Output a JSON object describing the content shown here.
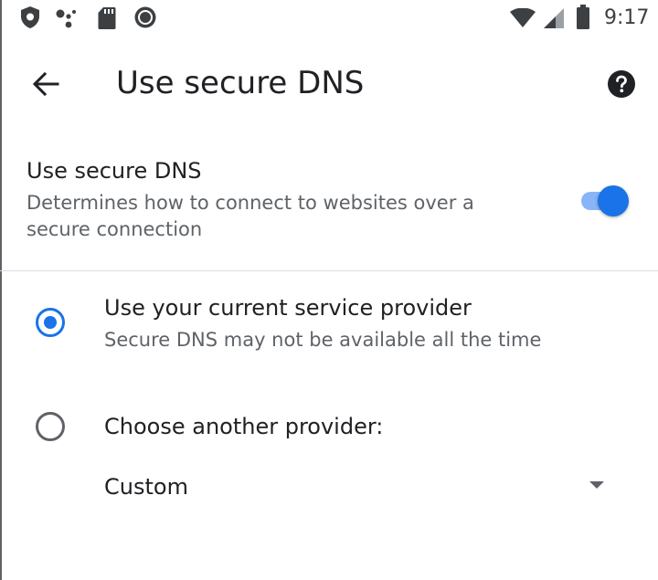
{
  "status_bar": {
    "time": "9:17",
    "icons": [
      "shield-icon",
      "assistant-dots-icon",
      "sd-card-icon",
      "record-icon",
      "wifi-icon",
      "cell-signal-icon",
      "battery-icon"
    ]
  },
  "app_bar": {
    "title": "Use secure DNS",
    "back_icon": "arrow-back-icon",
    "help_icon": "help-circle-icon"
  },
  "secure_dns_toggle": {
    "title": "Use secure DNS",
    "description": "Determines how to connect to websites over a secure connection",
    "enabled": true
  },
  "options": [
    {
      "label": "Use your current service provider",
      "sublabel": "Secure DNS may not be available all the time",
      "selected": true
    },
    {
      "label": "Choose another provider:",
      "selected": false
    }
  ],
  "provider_dropdown": {
    "selected": "Custom"
  },
  "colors": {
    "accent": "#1a73e8",
    "accent_light": "#8ab4f8",
    "text_primary": "#202124",
    "text_secondary": "#5f6368",
    "divider": "#dadce0"
  }
}
